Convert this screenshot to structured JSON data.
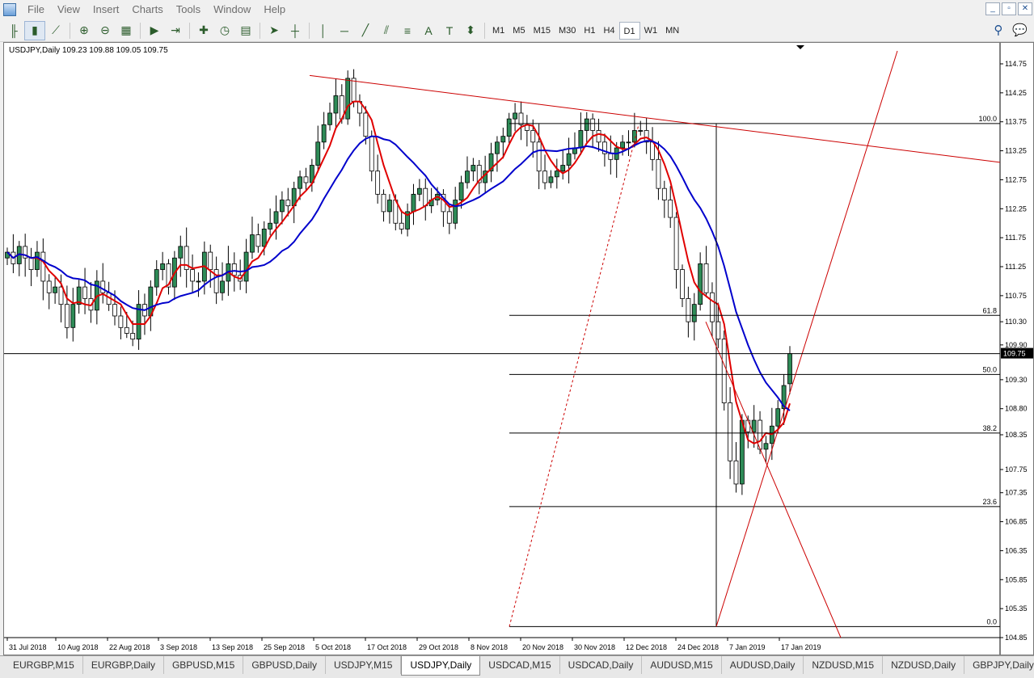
{
  "menu": [
    "File",
    "View",
    "Insert",
    "Charts",
    "Tools",
    "Window",
    "Help"
  ],
  "toolbar": {
    "timeframes": [
      "M1",
      "M5",
      "M15",
      "M30",
      "H1",
      "H4",
      "D1",
      "W1",
      "MN"
    ],
    "selected_timeframe": "D1"
  },
  "chart_title": "USDJPY,Daily  109.23 109.88 109.05 109.75",
  "colors": {
    "bull": "#2e8b57",
    "bear": "#ffffff",
    "ma_fast": "#e00000",
    "ma_slow": "#0000cc",
    "trend": "#cc0000"
  },
  "chart_data": {
    "type": "candlestick",
    "symbol": "USDJPY",
    "timeframe": "Daily",
    "ohlc": {
      "open": 109.23,
      "high": 109.88,
      "low": 109.05,
      "close": 109.75
    },
    "current_price_label": "109.75",
    "ylim": [
      104.85,
      114.75
    ],
    "y_ticks": [
      "114.75",
      "114.25",
      "113.75",
      "113.25",
      "112.75",
      "112.25",
      "111.75",
      "111.25",
      "110.75",
      "110.30",
      "109.90",
      "109.30",
      "108.80",
      "108.35",
      "107.75",
      "107.35",
      "106.85",
      "106.35",
      "105.85",
      "105.35",
      "104.85"
    ],
    "x_ticks": [
      "31 Jul 2018",
      "10 Aug 2018",
      "22 Aug 2018",
      "3 Sep 2018",
      "13 Sep 2018",
      "25 Sep 2018",
      "5 Oct 2018",
      "17 Oct 2018",
      "29 Oct 2018",
      "8 Nov 2018",
      "20 Nov 2018",
      "30 Nov 2018",
      "12 Dec 2018",
      "24 Dec 2018",
      "7 Jan 2019",
      "17 Jan 2019"
    ],
    "fibonacci": [
      {
        "level": "100.0",
        "price": 113.72
      },
      {
        "level": "61.8",
        "price": 110.41
      },
      {
        "level": "50.0",
        "price": 109.39
      },
      {
        "level": "38.2",
        "price": 108.38
      },
      {
        "level": "23.6",
        "price": 107.11
      },
      {
        "level": "0.0",
        "price": 105.04
      }
    ],
    "closes": [
      111.5,
      111.3,
      111.6,
      111.4,
      111.2,
      111.5,
      111.0,
      110.8,
      110.9,
      110.6,
      110.2,
      110.6,
      110.9,
      110.7,
      110.5,
      111.0,
      110.8,
      110.6,
      110.4,
      110.2,
      110.1,
      110.0,
      110.6,
      110.4,
      110.9,
      111.2,
      111.3,
      110.9,
      111.4,
      111.6,
      111.2,
      111.0,
      111.0,
      111.5,
      111.2,
      110.8,
      111.0,
      111.3,
      111.1,
      111.0,
      111.5,
      111.8,
      111.6,
      111.9,
      112.0,
      112.2,
      112.4,
      112.3,
      112.6,
      112.8,
      112.7,
      113.0,
      113.4,
      113.7,
      113.9,
      114.2,
      113.8,
      114.5,
      114.1,
      113.9,
      113.5,
      112.9,
      112.5,
      112.2,
      112.4,
      112.0,
      111.9,
      112.2,
      112.5,
      112.6,
      112.3,
      112.4,
      112.5,
      112.2,
      112.0,
      112.4,
      112.7,
      112.9,
      113.0,
      112.7,
      112.9,
      113.2,
      113.4,
      113.5,
      113.8,
      113.9,
      113.7,
      113.6,
      113.4,
      112.9,
      112.7,
      112.8,
      112.9,
      113.0,
      113.2,
      113.3,
      113.6,
      113.8,
      113.6,
      113.4,
      113.2,
      113.1,
      113.3,
      113.4,
      113.4,
      113.6,
      113.6,
      113.4,
      113.1,
      112.6,
      112.4,
      112.1,
      111.2,
      110.7,
      110.3,
      110.6,
      111.3,
      110.8,
      110.3,
      110.0,
      108.9,
      107.9,
      107.5,
      108.6,
      108.4,
      108.6,
      108.1,
      108.2,
      108.5,
      108.8,
      109.2,
      109.75
    ]
  },
  "tabs": [
    "EURGBP,M15",
    "EURGBP,Daily",
    "GBPUSD,M15",
    "GBPUSD,Daily",
    "USDJPY,M15",
    "USDJPY,Daily",
    "USDCAD,M15",
    "USDCAD,Daily",
    "AUDUSD,M15",
    "AUDUSD,Daily",
    "NZDUSD,M15",
    "NZDUSD,Daily",
    "GBPJPY,Daily"
  ],
  "active_tab": "USDJPY,Daily"
}
